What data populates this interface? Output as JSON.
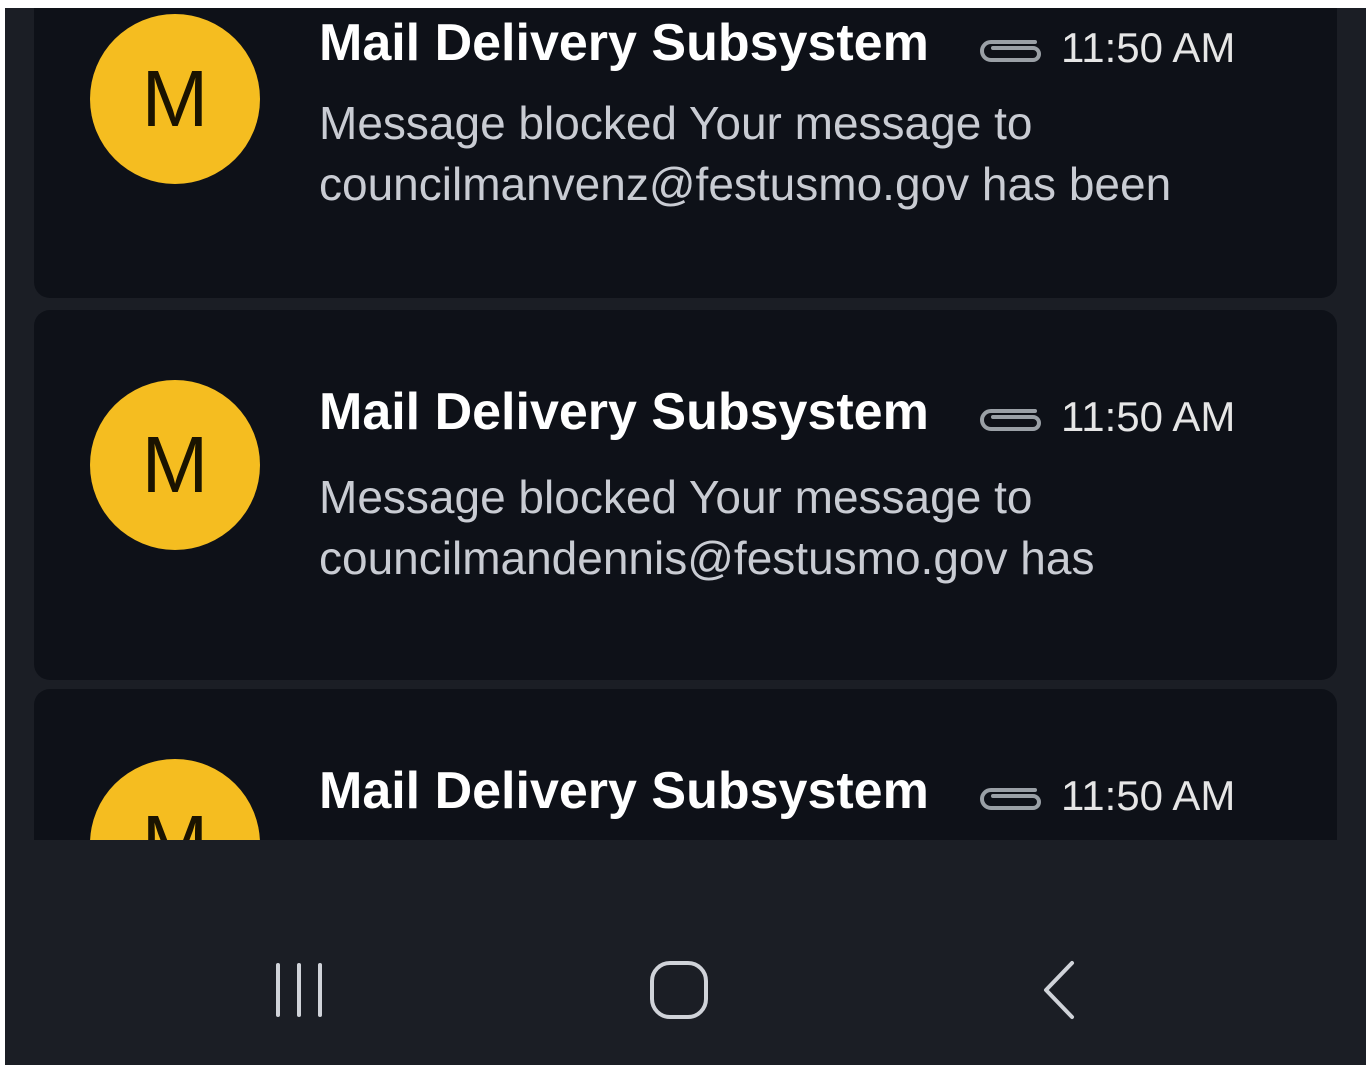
{
  "emails": [
    {
      "avatar_letter": "M",
      "sender": "Mail Delivery Subsystem",
      "time": "11:50 AM",
      "has_attachment": true,
      "snippet": "Message blocked Your message to\ncouncilmanvenz@festusmo.gov has been"
    },
    {
      "avatar_letter": "M",
      "sender": "Mail Delivery Subsystem",
      "time": "11:50 AM",
      "has_attachment": true,
      "snippet": "Message blocked Your message to\ncouncilmandennis@festusmo.gov has"
    },
    {
      "avatar_letter": "M",
      "sender": "Mail Delivery Subsystem",
      "time": "11:50 AM",
      "has_attachment": true,
      "snippet": ""
    }
  ],
  "nav": {
    "recents": "recents-icon",
    "home": "home-icon",
    "back": "back-icon"
  },
  "colors": {
    "background": "#1b1e25",
    "card": "#0e1118",
    "avatar": "#f5bd20"
  }
}
